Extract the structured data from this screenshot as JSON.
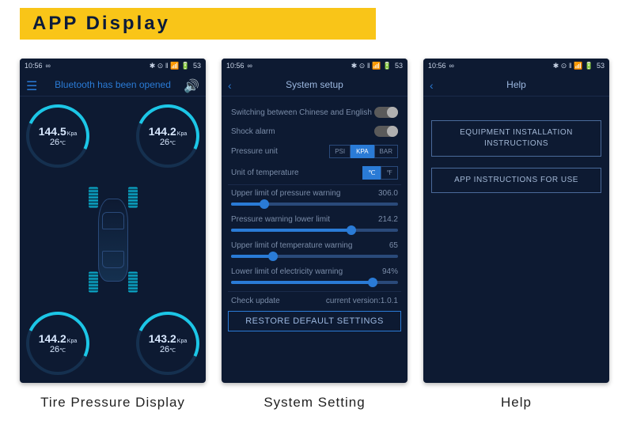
{
  "banner": {
    "title": "APP Display"
  },
  "status": {
    "time": "10:56",
    "link": "∞",
    "icons": "✱ ⊙ ‖ 📶 🔋",
    "battery": "53"
  },
  "phone1": {
    "title": "Bluetooth has been opened",
    "caption": "Tire Pressure Display",
    "pressure_unit": "Kpa",
    "temp_unit": "℃",
    "tires": {
      "tl": {
        "pressure": "144.5",
        "temp": "26"
      },
      "tr": {
        "pressure": "144.2",
        "temp": "26"
      },
      "bl": {
        "pressure": "144.2",
        "temp": "26"
      },
      "br": {
        "pressure": "143.2",
        "temp": "26"
      }
    }
  },
  "phone2": {
    "title": "System setup",
    "caption": "System Setting",
    "rows": {
      "lang": "Switching between Chinese and English",
      "shock": "Shock alarm",
      "punit": "Pressure unit",
      "tunit": "Unit of temperature",
      "punit_opts": {
        "psi": "PSI",
        "kpa": "KPA",
        "bar": "BAR"
      },
      "tunit_opts": {
        "c": "℃",
        "f": "℉"
      }
    },
    "sliders": {
      "s1": {
        "label": "Upper limit of pressure warning",
        "val": "306.0",
        "pct": 20
      },
      "s2": {
        "label": "Pressure warning lower limit",
        "val": "214.2",
        "pct": 72
      },
      "s3": {
        "label": "Upper limit of temperature warning",
        "val": "65",
        "pct": 25
      },
      "s4": {
        "label": "Lower limit of electricity warning",
        "val": "94%",
        "pct": 85
      }
    },
    "check_update": "Check update",
    "version_label": "current version:",
    "version": "1.0.1",
    "restore": "RESTORE DEFAULT SETTINGS"
  },
  "phone3": {
    "title": "Help",
    "caption": "Help",
    "btn1": "EQUIPMENT INSTALLATION INSTRUCTIONS",
    "btn2": "APP INSTRUCTIONS FOR USE"
  }
}
